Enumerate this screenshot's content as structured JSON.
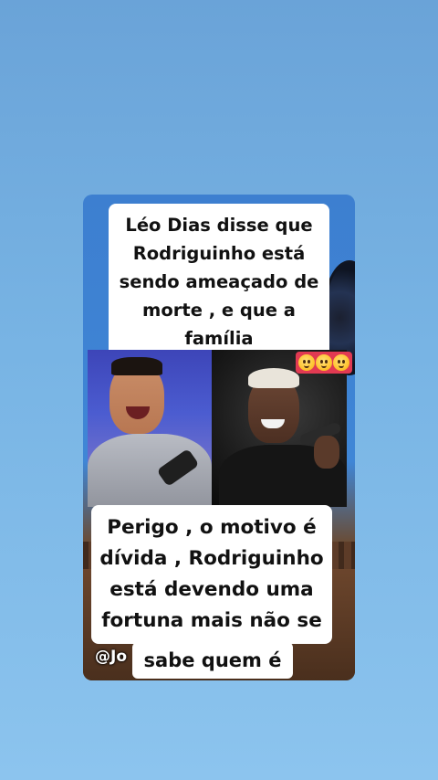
{
  "post": {
    "caption_top": "Léo Dias disse que\nRodriguinho está\nsendo ameaçado de\nmorte , e que a família\ndele também está em",
    "caption_bottom": "Perigo , o motivo é\ndívida , Rodriguinho\nestá devendo uma\nfortuna mais não se",
    "caption_tail": "sabe quem é",
    "watermark": "@Jo",
    "emoji_icons": [
      "flushed-face-icon",
      "flushed-face-icon",
      "flushed-face-icon"
    ],
    "emoji_strip_color": "#e13a52"
  },
  "background": {
    "gradient_top": "#6aa3d8",
    "gradient_bottom": "#8cc4ee"
  }
}
